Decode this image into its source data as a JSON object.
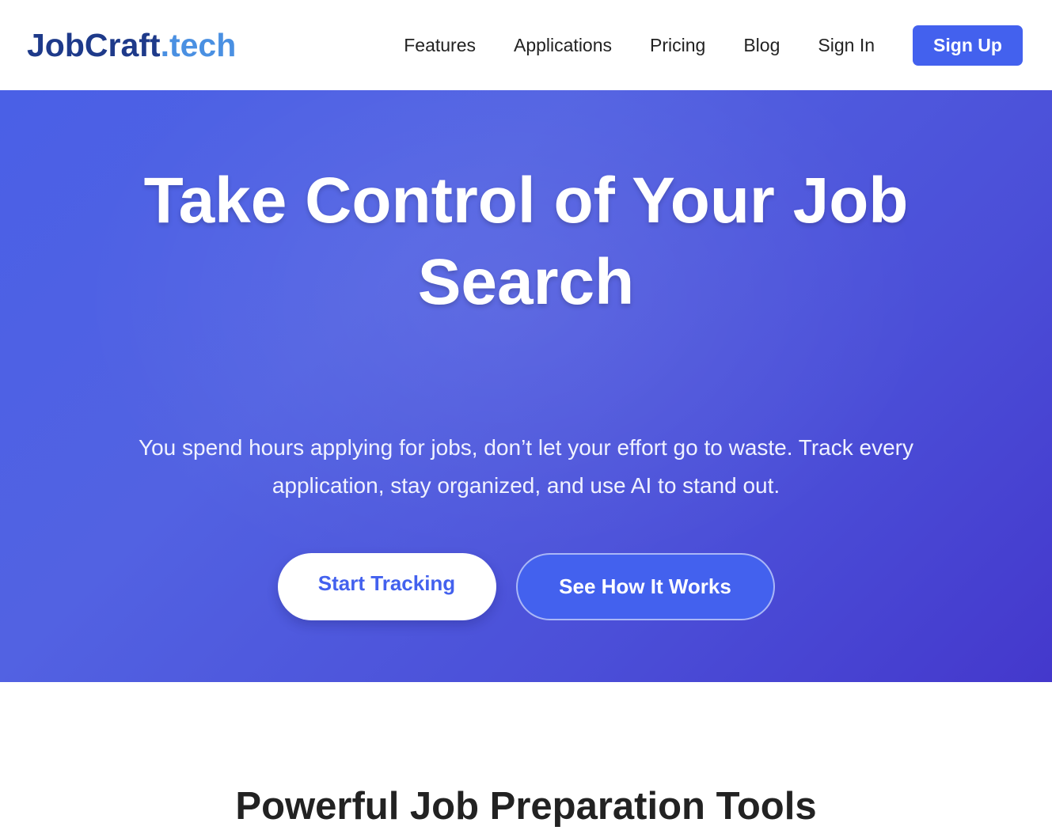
{
  "header": {
    "logo_main": "JobCraft",
    "logo_accent": ".tech",
    "nav": [
      {
        "label": "Features"
      },
      {
        "label": "Applications"
      },
      {
        "label": "Pricing"
      },
      {
        "label": "Blog"
      },
      {
        "label": "Sign In"
      }
    ],
    "signup_label": "Sign Up"
  },
  "hero": {
    "title": "Take Control of Your Job Search",
    "subtitle": "You spend hours applying for jobs, don’t let your effort go to waste. Track every application, stay organized, and use AI to stand out.",
    "primary_button": "Start Tracking",
    "secondary_button": "See How It Works"
  },
  "features": {
    "title": "Powerful Job Preparation Tools"
  },
  "colors": {
    "brand_dark": "#1e3a8a",
    "brand_accent": "#4a90e2",
    "primary": "#4361ee",
    "hero_gradient_start": "#4a60e6",
    "hero_gradient_end": "#4438cc"
  }
}
